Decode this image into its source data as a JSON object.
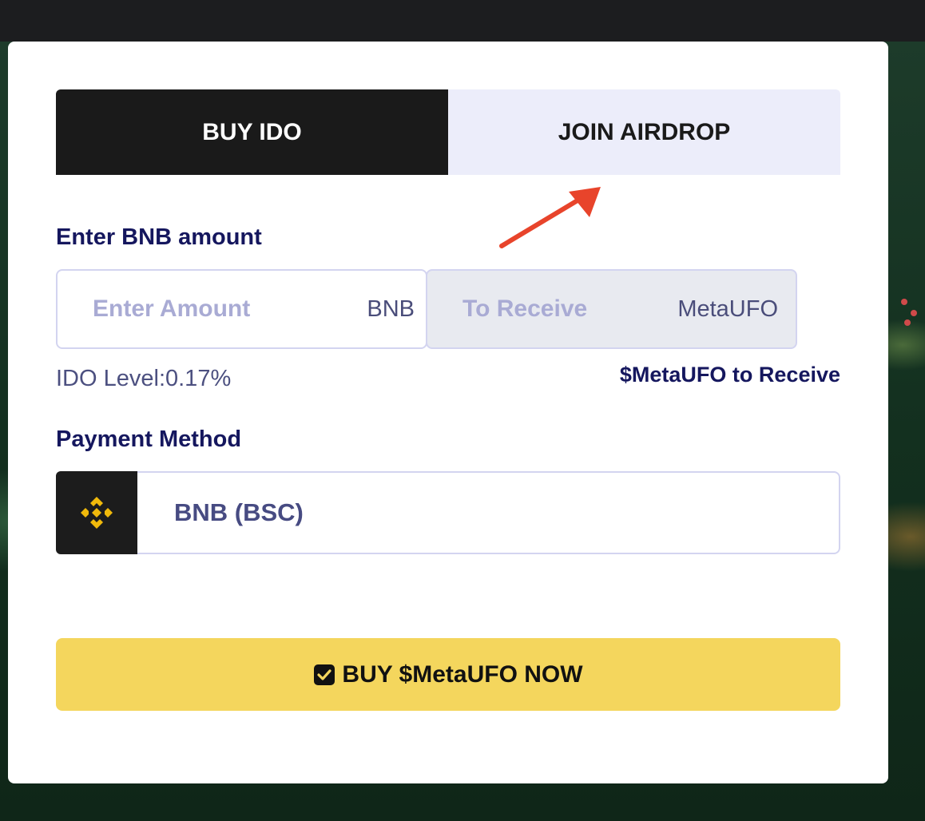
{
  "tabs": {
    "buy_ido": "BUY IDO",
    "join_airdrop": "JOIN AIRDROP"
  },
  "amount": {
    "label": "Enter BNB amount",
    "placeholder": "Enter Amount",
    "unit": "BNB"
  },
  "receive": {
    "placeholder": "To Receive",
    "unit": "MetaUFO"
  },
  "ido_level": "IDO Level:0.17%",
  "receive_label": "$MetaUFO to Receive",
  "payment": {
    "label": "Payment Method",
    "icon": "binance-logo-icon",
    "value": "BNB (BSC)"
  },
  "buy_button": {
    "icon": "checkbox-icon",
    "label": "BUY $MetaUFO NOW"
  },
  "colors": {
    "accent_yellow": "#f4d65d",
    "binance_gold": "#f0b90b",
    "navy_text": "#15175e",
    "annotation_arrow": "#e8442b"
  }
}
